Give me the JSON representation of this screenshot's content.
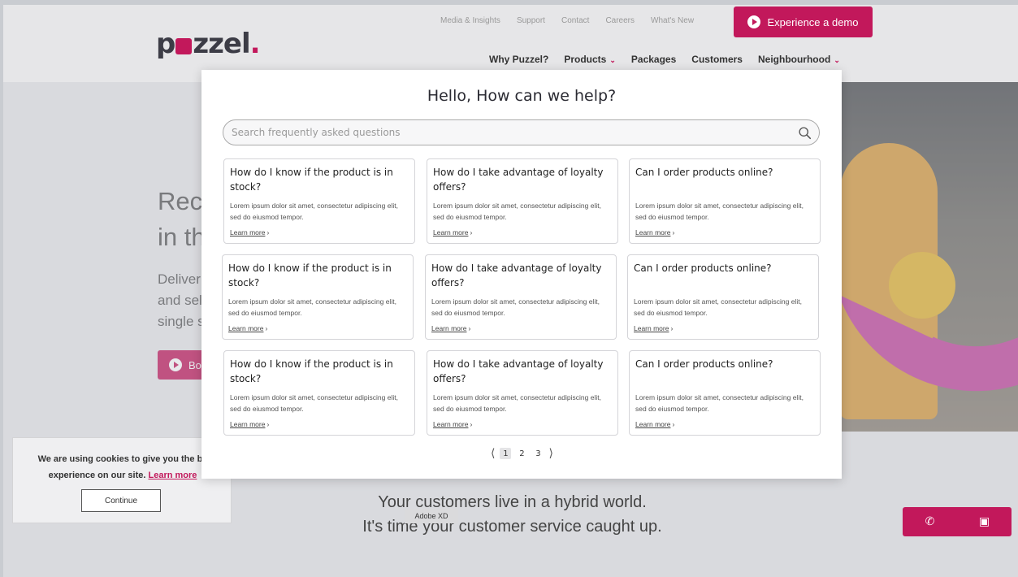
{
  "header": {
    "logo": "puzzel",
    "top_links": [
      "Media & Insights",
      "Support",
      "Contact",
      "Careers",
      "What's New"
    ],
    "demo_button": "Experience a demo",
    "nav": [
      {
        "label": "Why Puzzel?",
        "dropdown": false
      },
      {
        "label": "Products",
        "dropdown": true
      },
      {
        "label": "Packages",
        "dropdown": false
      },
      {
        "label": "Customers",
        "dropdown": false
      },
      {
        "label": "Neighbourhood",
        "dropdown": true
      }
    ]
  },
  "hero": {
    "line1": "Rec",
    "line2": "in th",
    "para1": "Deliver",
    "para2": "and sel",
    "para3": "single s",
    "cta": "Bo"
  },
  "cookie": {
    "text_before": "We are using cookies to give you the be",
    "text_line2": "experience on our site.",
    "learn_more": "Learn more",
    "continue": "Continue"
  },
  "tagline": {
    "line1": "Your customers live in a hybrid world.",
    "line2": "It's time your customer service caught up."
  },
  "xd_badge": "Adobe XD",
  "modal": {
    "title": "Hello, How can we help?",
    "search_placeholder": "Search frequently asked questions",
    "cards": [
      {
        "q": "How do I know if the product is in stock?",
        "a": "Lorem ipsum dolor sit amet, consectetur adipiscing elit, sed do eiusmod tempor.",
        "link": "Learn more"
      },
      {
        "q": "How do I take advantage of loyalty offers?",
        "a": "Lorem ipsum dolor sit amet, consectetur adipiscing elit, sed do eiusmod tempor.",
        "link": "Learn more"
      },
      {
        "q": "Can I order products online?",
        "a": "Lorem ipsum dolor sit amet, consectetur adipiscing elit, sed do eiusmod tempor.",
        "link": "Learn more"
      },
      {
        "q": "How do I know if the product is in stock?",
        "a": "Lorem ipsum dolor sit amet, consectetur adipiscing elit, sed do eiusmod tempor.",
        "link": "Learn more"
      },
      {
        "q": "How do I take advantage of loyalty offers?",
        "a": "Lorem ipsum dolor sit amet, consectetur adipiscing elit, sed do eiusmod tempor.",
        "link": "Learn more"
      },
      {
        "q": "Can I order products online?",
        "a": "Lorem ipsum dolor sit amet, consectetur adipiscing elit, sed do eiusmod tempor.",
        "link": "Learn more"
      },
      {
        "q": "How do I know if the product is in stock?",
        "a": "Lorem ipsum dolor sit amet, consectetur adipiscing elit, sed do eiusmod tempor.",
        "link": "Learn more"
      },
      {
        "q": "How do I take advantage of loyalty offers?",
        "a": "Lorem ipsum dolor sit amet, consectetur adipiscing elit, sed do eiusmod tempor.",
        "link": "Learn more"
      },
      {
        "q": "Can I order products online?",
        "a": "Lorem ipsum dolor sit amet, consectetur adipiscing elit, sed do eiusmod tempor.",
        "link": "Learn more"
      }
    ],
    "pagination": {
      "pages": [
        "1",
        "2",
        "3"
      ],
      "current": "1"
    }
  },
  "icons": {
    "search": "search-icon",
    "play": "play-icon",
    "phone": "phone-icon",
    "chat": "chat-icon"
  },
  "colors": {
    "brand": "#c2185b",
    "accent_purple": "#c2439b",
    "accent_yellow": "#e2b32e"
  }
}
